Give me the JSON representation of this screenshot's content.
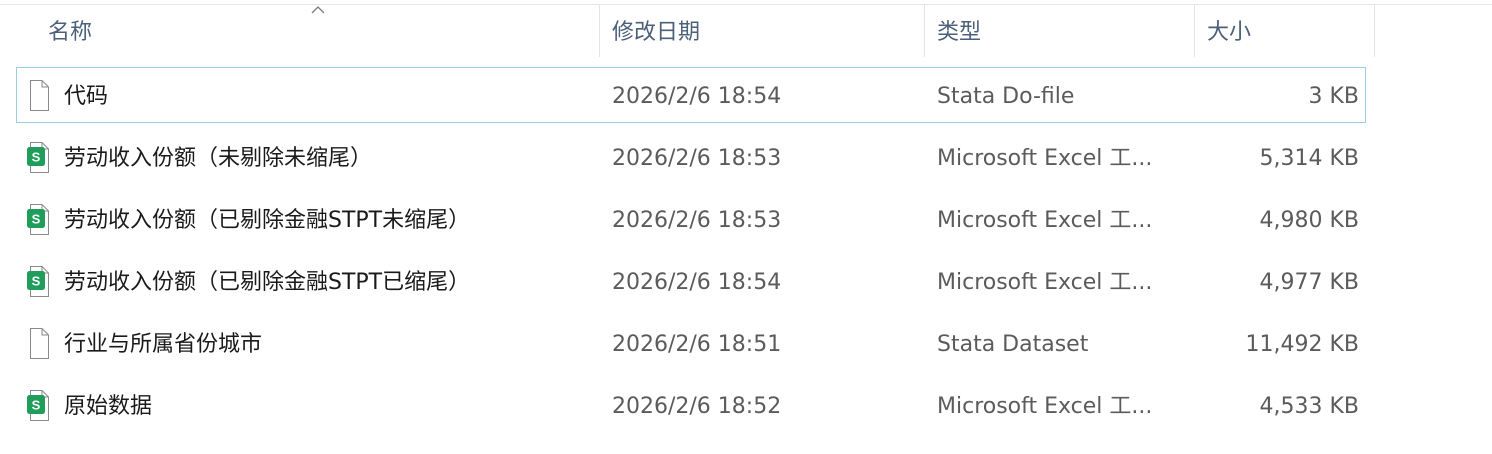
{
  "columns": {
    "name": "名称",
    "modified": "修改日期",
    "type": "类型",
    "size": "大小"
  },
  "files": [
    {
      "name": "代码",
      "modified": "2026/2/6 18:54",
      "type": "Stata Do-file",
      "size": "3 KB",
      "icon": "blank-file-icon",
      "selected": true
    },
    {
      "name": "劳动收入份额（未剔除未缩尾）",
      "modified": "2026/2/6 18:53",
      "type": "Microsoft Excel 工...",
      "size": "5,314 KB",
      "icon": "spreadsheet-file-icon",
      "selected": false
    },
    {
      "name": "劳动收入份额（已剔除金融STPT未缩尾）",
      "modified": "2026/2/6 18:53",
      "type": "Microsoft Excel 工...",
      "size": "4,980 KB",
      "icon": "spreadsheet-file-icon",
      "selected": false
    },
    {
      "name": "劳动收入份额（已剔除金融STPT已缩尾）",
      "modified": "2026/2/6 18:54",
      "type": "Microsoft Excel 工...",
      "size": "4,977 KB",
      "icon": "spreadsheet-file-icon",
      "selected": false
    },
    {
      "name": "行业与所属省份城市",
      "modified": "2026/2/6 18:51",
      "type": "Stata Dataset",
      "size": "11,492 KB",
      "icon": "blank-file-icon",
      "selected": false
    },
    {
      "name": "原始数据",
      "modified": "2026/2/6 18:52",
      "type": "Microsoft Excel 工...",
      "size": "4,533 KB",
      "icon": "spreadsheet-file-icon",
      "selected": false
    }
  ],
  "icon_letter": "S",
  "colors": {
    "excel_green": "#1e9e5a",
    "selection_border": "#99d1e4",
    "header_text": "#4c607a"
  },
  "sort": {
    "column": "name",
    "direction": "ascending"
  }
}
